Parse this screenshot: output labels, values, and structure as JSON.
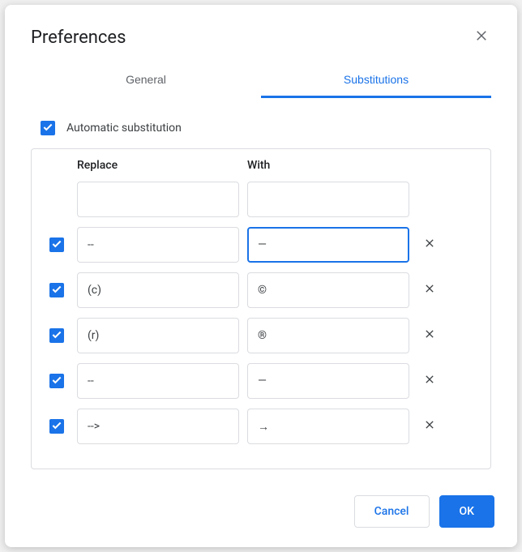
{
  "dialog": {
    "title": "Preferences"
  },
  "tabs": {
    "general": "General",
    "substitutions": "Substitutions"
  },
  "autoSub": {
    "label": "Automatic substitution",
    "checked": true
  },
  "headers": {
    "replace": "Replace",
    "with": "With"
  },
  "rows": [
    {
      "checked": null,
      "replace": "",
      "with": "",
      "deletable": false,
      "focused": false
    },
    {
      "checked": true,
      "replace": "--",
      "with": "—",
      "deletable": true,
      "focused": true
    },
    {
      "checked": true,
      "replace": "(c)",
      "with": "©",
      "deletable": true,
      "focused": false
    },
    {
      "checked": true,
      "replace": "(r)",
      "with": "®",
      "deletable": true,
      "focused": false
    },
    {
      "checked": true,
      "replace": "--",
      "with": "—",
      "deletable": true,
      "focused": false
    },
    {
      "checked": true,
      "replace": "-->",
      "with": "→",
      "deletable": true,
      "focused": false
    }
  ],
  "buttons": {
    "cancel": "Cancel",
    "ok": "OK"
  }
}
